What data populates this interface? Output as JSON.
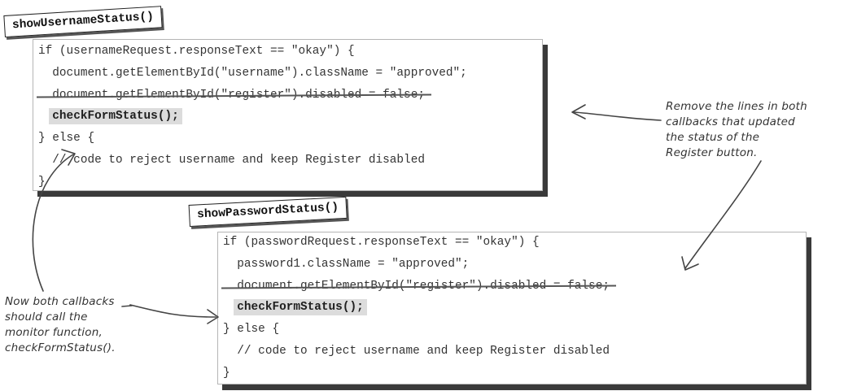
{
  "tab1": {
    "label": "showUsernameStatus()"
  },
  "tab2": {
    "label": "showPasswordStatus()"
  },
  "block1": {
    "lines": [
      "if (usernameRequest.responseText == \"okay\") {",
      "  document.getElementById(\"username\").className = \"approved\";",
      "  document.getElementById(\"register\").disabled = false;",
      "checkFormStatus();",
      "} else {",
      "  // code to reject username and keep Register disabled",
      "}"
    ]
  },
  "block2": {
    "lines": [
      "if (passwordRequest.responseText == \"okay\") {",
      "  password1.className = \"approved\";",
      "  document.getElementById(\"register\").disabled = false;",
      "checkFormStatus();",
      "} else {",
      "  // code to reject username and keep Register disabled",
      "}"
    ]
  },
  "note_right": {
    "lines": [
      "Remove the lines in both",
      "callbacks that updated",
      "the status of the",
      "Register button."
    ]
  },
  "note_left": {
    "lines": [
      "Now both callbacks",
      "should call the",
      "monitor function,",
      "checkFormStatus()."
    ]
  },
  "colors": {
    "code_text": "#333333",
    "highlight": "#dcdcdc",
    "shadow": "#3a3a3a",
    "ink": "#444444"
  }
}
